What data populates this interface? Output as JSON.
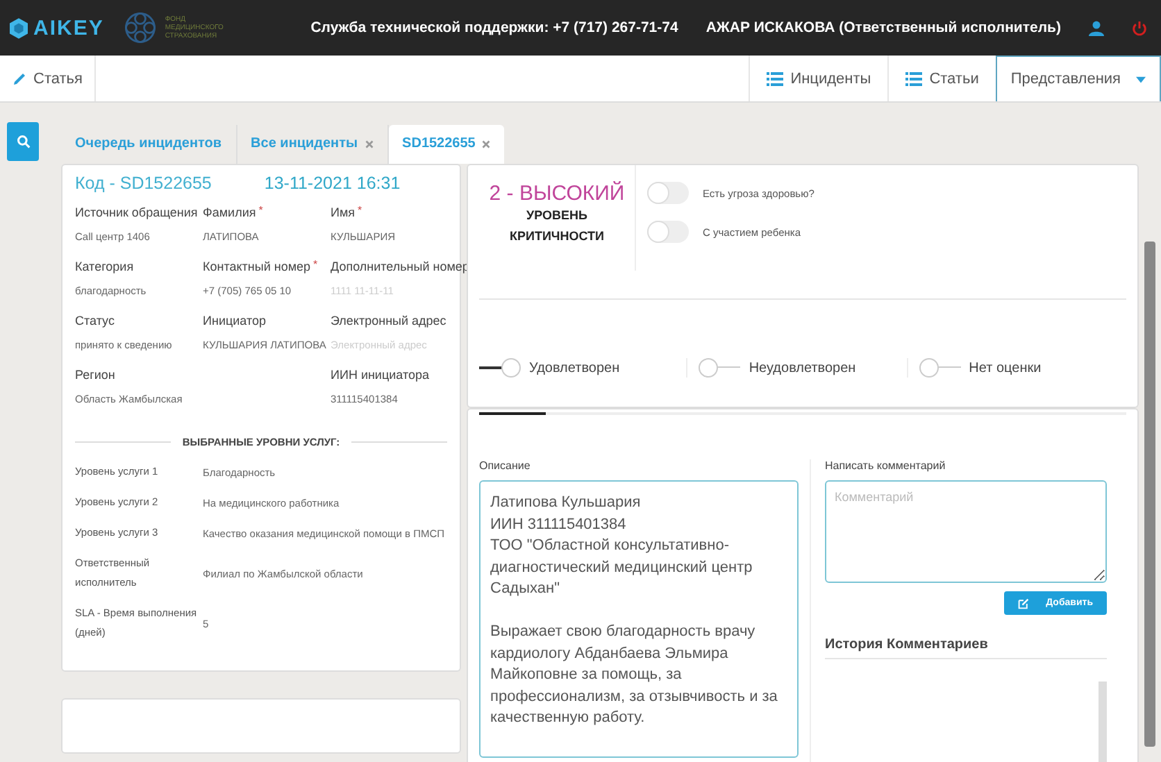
{
  "header": {
    "logo_text": "AIKEY",
    "fund_text": "ФОНД МЕДИЦИНСКОГО СТРАХОВАНИЯ",
    "support": "Служба технической поддержки: +7 (717) 267-71-74",
    "user": "АЖАР ИСКАКОВА (Ответственный исполнитель)"
  },
  "toolbar": {
    "left_button": "Статья",
    "right_buttons": [
      {
        "label": "Инциденты",
        "kind": "list",
        "selected": false
      },
      {
        "label": "Статьи",
        "kind": "list",
        "selected": false
      },
      {
        "label": "Представления",
        "kind": "dropdown",
        "selected": true
      }
    ]
  },
  "tabs": [
    {
      "label": "Очередь инцидентов",
      "closable": false,
      "selected": false
    },
    {
      "label": "Все инциденты",
      "closable": true,
      "selected": false
    },
    {
      "label": "SD1522655",
      "closable": true,
      "selected": true
    }
  ],
  "incident": {
    "required_mark": "*",
    "code": "Код - SD1522655",
    "date": "13-11-2021 16:31",
    "fields": [
      {
        "kind": "field",
        "label": "Источник обращения",
        "required": false,
        "value": "Call центр 1406"
      },
      {
        "kind": "field",
        "label": "Фамилия",
        "required": true,
        "value": "ЛАТИПОВА"
      },
      {
        "kind": "field",
        "label": "Имя",
        "required": true,
        "value": "КУЛЬШАРИЯ"
      },
      {
        "kind": "field",
        "label": "Категория",
        "required": false,
        "value": "благодарность"
      },
      {
        "kind": "field",
        "label": "Контактный номер",
        "required": true,
        "value": "+7 (705) 765 05 10"
      },
      {
        "kind": "field",
        "label": "Дополнительный номер",
        "required": false,
        "placeholder": "1111 11-11-11"
      },
      {
        "kind": "field",
        "label": "Статус",
        "required": false,
        "value": "принято к сведению"
      },
      {
        "kind": "field",
        "label": "Инициатор",
        "required": false,
        "value": "КУЛЬШАРИЯ ЛАТИПОВА"
      },
      {
        "kind": "field",
        "label": "Электронный адрес",
        "required": false,
        "placeholder": "Электронный адрес"
      },
      {
        "kind": "field",
        "label": "Регион",
        "required": false,
        "value": "Область Жамбылская"
      },
      {
        "kind": "blank"
      },
      {
        "kind": "field",
        "label": "ИИН инициатора",
        "required": false,
        "value": "311115401384"
      }
    ],
    "services_title": "ВЫБРАННЫЕ УРОВНИ УСЛУГ:",
    "services": [
      {
        "label": "Уровень услуги 1",
        "value": "Благодарность"
      },
      {
        "label": "Уровень услуги 2",
        "value": "На медицинского работника"
      },
      {
        "label": "Уровень услуги 3",
        "value": "Качество оказания медицинской помощи в ПМСП"
      },
      {
        "label": "Ответственный исполнитель",
        "value": "Филиал по Жамбылской области"
      },
      {
        "label": "SLA - Время выполнения (дней)",
        "value": "5"
      }
    ]
  },
  "criticality": {
    "level": "2 - ВЫСОКИЙ",
    "caption": "УРОВЕНЬ КРИТИЧНОСТИ",
    "toggles": [
      {
        "label": "Есть угроза здоровью?",
        "on": false
      },
      {
        "label": "С участием ребенка",
        "on": false
      }
    ]
  },
  "rating": [
    {
      "label": "Удовлетворен",
      "selected": true
    },
    {
      "label": "Неудовлетворен",
      "selected": false
    },
    {
      "label": "Нет оценки",
      "selected": false
    }
  ],
  "description": {
    "label": "Описание",
    "value": "Латипова Кульшария\nИИН 311115401384\nТОО \"Областной консультативно-\nдиагностический медицинский центр\nСадыхан\"\n\nВыражает свою благодарность врачу\nкардиологу Абданбаева Эльмира\nМайкоповне за помощь, за\nпрофессионализм, за отзывчивость и за\nкачественную работу."
  },
  "comment": {
    "label": "Написать комментарий",
    "placeholder": "Комментарий",
    "button": "Добавить",
    "history_title": "История Комментариев"
  }
}
